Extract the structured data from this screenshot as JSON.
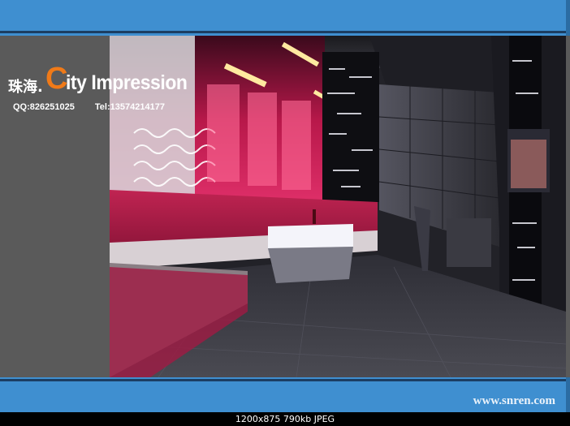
{
  "overlay": {
    "brand_chinese": "珠海.",
    "brand_initial": "C",
    "brand_rest": "ity Impression",
    "qq": "QQ:826251025",
    "tel": "Tel:13574214177"
  },
  "footer": {
    "website": "www.snren.com"
  },
  "status_bar": {
    "image_info": "1200x875  790kb  JPEG"
  },
  "colors": {
    "frame_blue": "#3f8fd0",
    "brand_orange": "#f07a18",
    "panel_gray": "#5a5a5a"
  }
}
